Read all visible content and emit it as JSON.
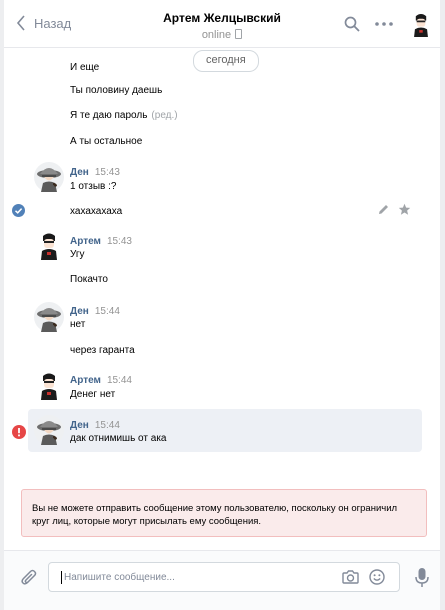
{
  "header": {
    "back_label": "Назад",
    "peer_name": "Артем Желцывский",
    "peer_status": "online"
  },
  "date_separator": "сегодня",
  "colors": {
    "link": "#42648b",
    "check": "#5181b8",
    "error": "#e64646"
  },
  "messages": [
    {
      "text": "И еще"
    },
    {
      "text": "Ты половину даешь"
    },
    {
      "text": "Я те даю пароль",
      "edited": "(ред.)"
    },
    {
      "text": "А ты остальное"
    },
    {
      "author": "Ден",
      "time": "15:43",
      "text": "1 отзыв :?"
    },
    {
      "text": "хахахахаха",
      "selected": true
    },
    {
      "author": "Артем",
      "time": "15:43",
      "text": "Угу"
    },
    {
      "text": "Покачто"
    },
    {
      "author": "Ден",
      "time": "15:44",
      "text": "нет"
    },
    {
      "text": "через гаранта"
    },
    {
      "author": "Артем",
      "time": "15:44",
      "text": "Денег нет"
    },
    {
      "author": "Ден",
      "time": "15:44",
      "text": "дак отнимишь от ака",
      "error": true
    }
  ],
  "notice": "Вы не можете отправить сообщение этому пользователю, поскольку он ограничил круг лиц, которые могут присылать ему сообщения.",
  "composer": {
    "placeholder": "Напишите сообщение..."
  },
  "icons": [
    "chevron-left-icon",
    "search-icon",
    "more-icon",
    "phone-icon",
    "check-icon",
    "pencil-icon",
    "star-icon",
    "error-icon",
    "attach-icon",
    "camera-icon",
    "smile-icon",
    "mic-icon"
  ]
}
